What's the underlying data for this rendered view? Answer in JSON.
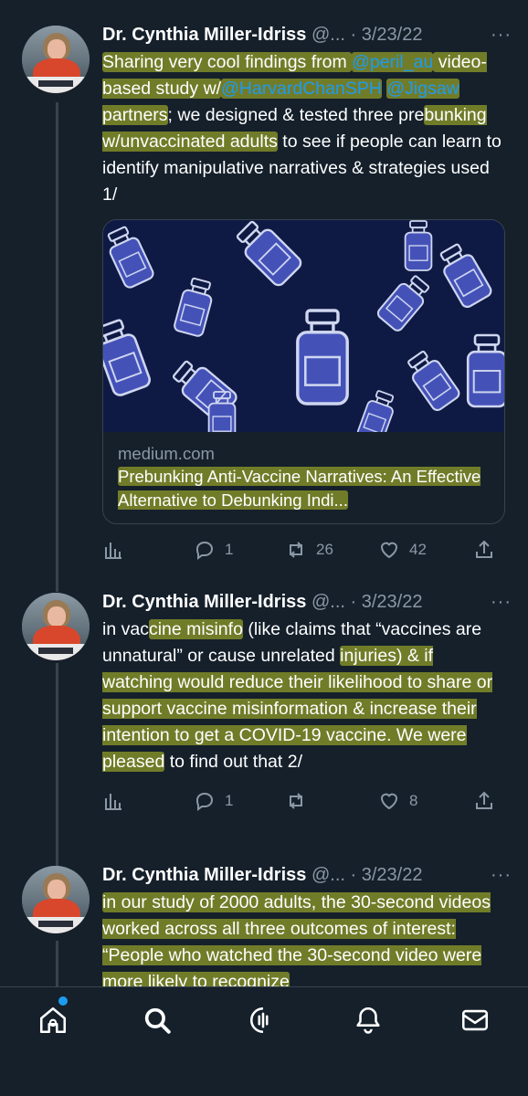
{
  "tweets": [
    {
      "name": "Dr. Cynthia Miller-Idriss",
      "handle": "@...",
      "date": " · 3/23/22",
      "more": "···",
      "text_parts": [
        {
          "t": "Sharing very cool findings from ",
          "c": "hl"
        },
        {
          "t": "@peril_au",
          "c": "mention hl"
        },
        {
          "t": " video-based study w/",
          "c": "hl"
        },
        {
          "t": "@HarvardChanSPH",
          "c": "mention hl"
        },
        {
          "t": " ",
          "c": ""
        },
        {
          "t": "@Jigsaw",
          "c": "mention hl"
        },
        {
          "t": " partners",
          "c": "hl"
        },
        {
          "t": "; we designed & tested three pre",
          "c": ""
        },
        {
          "t": "bunking w/unvaccinated adults",
          "c": "hl"
        },
        {
          "t": " to see if people can learn to identify manipulative narratives & strategies used 1/",
          "c": ""
        }
      ],
      "card": {
        "domain": "medium.com",
        "title": "Prebunking Anti-Vaccine Narratives: An Effective Alternative to Debunking Indi..."
      },
      "replies": "1",
      "retweets": "26",
      "likes": "42"
    },
    {
      "name": "Dr. Cynthia Miller-Idriss",
      "handle": "@...",
      "date": " · 3/23/22",
      "more": "···",
      "text_parts": [
        {
          "t": "in vac",
          "c": ""
        },
        {
          "t": "cine misinfo",
          "c": "hl"
        },
        {
          "t": " (like claims that “vaccines are unnatural” or cause unrelated ",
          "c": ""
        },
        {
          "t": "injuries) & if watching would reduce their likelihood to share or support vaccine misinformation & increase their intention to get a COVID-19 vaccine. We were pleased",
          "c": "hl"
        },
        {
          "t": " to find out that 2/",
          "c": ""
        }
      ],
      "replies": "1",
      "retweets": "",
      "likes": "8"
    },
    {
      "name": "Dr. Cynthia Miller-Idriss",
      "handle": "@...",
      "date": " · 3/23/22",
      "more": "···",
      "text_parts": [
        {
          "t": "in our study of 2000 adults, the 30-second videos worked across all three outcomes of interest: “People who watched the 30-second video were more likely to recognize",
          "c": "hl"
        }
      ]
    }
  ],
  "nav": {
    "items": [
      "home-icon",
      "search-icon",
      "spaces-icon",
      "notifications-icon",
      "messages-icon"
    ]
  },
  "colors": {
    "background": "#15202b",
    "accent": "#1d9bf0",
    "muted": "#8b98a5",
    "highlight": "#bec828"
  }
}
